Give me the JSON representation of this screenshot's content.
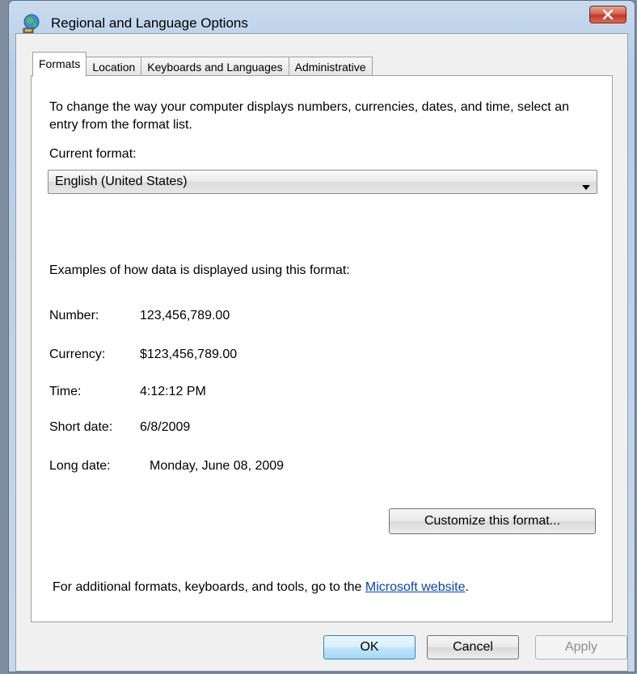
{
  "window": {
    "title": "Regional and Language Options"
  },
  "tabs": [
    {
      "label": "Formats",
      "active": true
    },
    {
      "label": "Location",
      "active": false
    },
    {
      "label": "Keyboards and Languages",
      "active": false
    },
    {
      "label": "Administrative",
      "active": false
    }
  ],
  "formats": {
    "intro": "To change the way your computer displays numbers, currencies, dates, and time, select an entry from the format list.",
    "current_format_label": "Current format:",
    "current_format_value": "English (United States)",
    "examples_label": "Examples of how data is displayed using this format:",
    "examples": [
      {
        "key": "Number:",
        "value": "123,456,789.00"
      },
      {
        "key": "Currency:",
        "value": "$123,456,789.00"
      },
      {
        "key": "Time:",
        "value": "4:12:12 PM"
      },
      {
        "key": "Short date:",
        "value": "6/8/2009"
      },
      {
        "key": "Long date:",
        "value": "Monday, June 08, 2009"
      }
    ],
    "customize_label": "Customize this format...",
    "footer_prefix": "For additional formats, keyboards, and tools, go to the ",
    "footer_link": "Microsoft website",
    "footer_suffix": "."
  },
  "buttons": {
    "ok": "OK",
    "cancel": "Cancel",
    "apply": "Apply"
  },
  "colors": {
    "link": "#0645ad",
    "close_button": "#c0382a",
    "ok_button_border": "#3c7fb1"
  },
  "icons": {
    "title": "globe-icon",
    "close": "close-icon",
    "dropdown": "chevron-down-icon"
  }
}
